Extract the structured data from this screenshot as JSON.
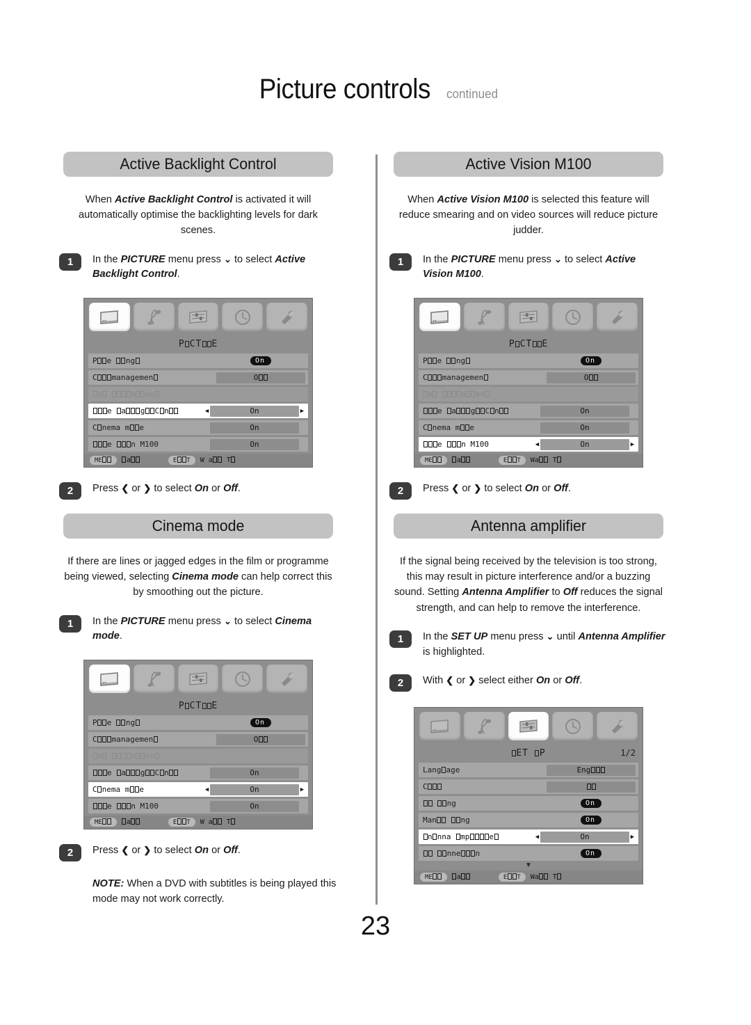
{
  "page": {
    "title": "Picture controls",
    "title_suffix": "continued",
    "number": "23"
  },
  "sections": {
    "active_backlight": {
      "heading": "Active Backlight Control",
      "body_prefix": "When ",
      "body_italic": "Active Backlight Control",
      "body_suffix": " is activated it will automatically optimise the backlighting levels for dark scenes.",
      "step1_number": "1",
      "step1_a": "In the ",
      "step1_menu": "PICTURE",
      "step1_b": " menu press ",
      "step1_arrow": "⌄",
      "step1_c": " to select ",
      "step1_target": "Active Backlight Control",
      "step1_d": ".",
      "step2_number": "2",
      "step2_a": "Press ",
      "step2_left": "❮",
      "step2_b": " or ",
      "step2_right": "❯",
      "step2_c": " to select ",
      "step2_on": "On",
      "step2_d": " or ",
      "step2_off": "Off",
      "step2_e": "."
    },
    "active_vision": {
      "heading": "Active Vision M100",
      "body_prefix": "When ",
      "body_italic": "Active Vision M100",
      "body_suffix": " is selected this feature will reduce smearing and on video sources will reduce picture judder.",
      "step1_number": "1",
      "step1_a": "In the ",
      "step1_menu": "PICTURE",
      "step1_b": " menu press ",
      "step1_arrow": "⌄",
      "step1_c": " to select ",
      "step1_target": "Active Vision M100",
      "step1_d": ".",
      "step2_number": "2",
      "step2_a": "Press ",
      "step2_left": "❮",
      "step2_b": " or ",
      "step2_right": "❯",
      "step2_c": " to select ",
      "step2_on": "On",
      "step2_d": " or ",
      "step2_off": "Off",
      "step2_e": "."
    },
    "cinema_mode": {
      "heading": "Cinema mode",
      "body_a": "If there are lines or jagged edges in the film or programme being viewed, selecting ",
      "body_italic": "Cinema mode",
      "body_b": " can help correct this by smoothing out the picture.",
      "step1_number": "1",
      "step1_a": "In the ",
      "step1_menu": "PICTURE",
      "step1_b": " menu press ",
      "step1_arrow": "⌄",
      "step1_c": " to select ",
      "step1_target": "Cinema mode",
      "step1_d": ".",
      "step2_number": "2",
      "step2_a": "Press ",
      "step2_left": "❮",
      "step2_b": " or ",
      "step2_right": "❯",
      "step2_c": " to select ",
      "step2_on": "On",
      "step2_d": " or ",
      "step2_off": "Off",
      "step2_e": ".",
      "note_label": "NOTE:",
      "note_text": " When a DVD with subtitles is being played this mode may not work correctly."
    },
    "antenna_amplifier": {
      "heading": "Antenna amplifier",
      "body_a": "If the signal being received by the television is too strong, this may result in picture interference and/or a buzzing sound. Setting ",
      "body_italic": "Antenna Amplifier",
      "body_b": " to ",
      "body_off": "Off",
      "body_c": " reduces the signal strength, and can help to remove the interference.",
      "step1_number": "1",
      "step1_a": "In the ",
      "step1_menu": "SET UP",
      "step1_b": " menu press ",
      "step1_arrow": "⌄",
      "step1_c": " until ",
      "step1_target": "Antenna Amplifier",
      "step1_d": " is highlighted.",
      "step2_number": "2",
      "step2_a": "With ",
      "step2_left": "❮",
      "step2_b": " or ",
      "step2_right": "❯",
      "step2_c": " select either ",
      "step2_on": "On",
      "step2_d": " or ",
      "step2_off": "Off",
      "step2_e": "."
    }
  },
  "osd": {
    "picture_title": "PICTURE",
    "setup_title": "SET UP",
    "setup_page": "1/2",
    "icons": [
      "picture-icon",
      "sound-icon",
      "setup-sliders-icon",
      "timer-clock-icon",
      "preferences-wrench-icon"
    ],
    "footer": {
      "menu_key": "MENU",
      "menu_action": "Back",
      "exit_key": "EXIT",
      "exit_action": "Watch TV"
    },
    "picture_rows": [
      {
        "label": "Picture settings",
        "value": "On",
        "type": "pill"
      },
      {
        "label": "Colour management",
        "value": "Off",
        "type": "value"
      },
      {
        "label": "Base colour adjustment",
        "value": "",
        "type": "dim"
      },
      {
        "label": "Active backlight Control",
        "value": "On",
        "type": "value"
      },
      {
        "label": "Cinema mode",
        "value": "On",
        "type": "value"
      },
      {
        "label": "Active Vision M100",
        "value": "On",
        "type": "value"
      }
    ],
    "setup_rows": [
      {
        "label": "Language",
        "value": "English",
        "type": "value"
      },
      {
        "label": "Country",
        "value": "UK",
        "type": "value"
      },
      {
        "label": "Auto tuning",
        "value": "On",
        "type": "pill"
      },
      {
        "label": "Manual tuning",
        "value": "On",
        "type": "pill"
      },
      {
        "label": "Antenna Amplifier",
        "value": "On",
        "type": "value"
      },
      {
        "label": "Auto Connection",
        "value": "On",
        "type": "pill"
      }
    ],
    "selected": {
      "backlight_menu": "Active backlight Control",
      "vision_menu": "Active Vision M100",
      "cinema_menu": "Cinema mode",
      "setup_menu": "Antenna Amplifier"
    }
  },
  "colors": {
    "pill_grey": "#c2c2c2",
    "badge_dark": "#3c3c3c",
    "osd_bg": "#8e8e8e",
    "osd_row": "#a6a6a6",
    "osd_sel": "#ffffff"
  }
}
